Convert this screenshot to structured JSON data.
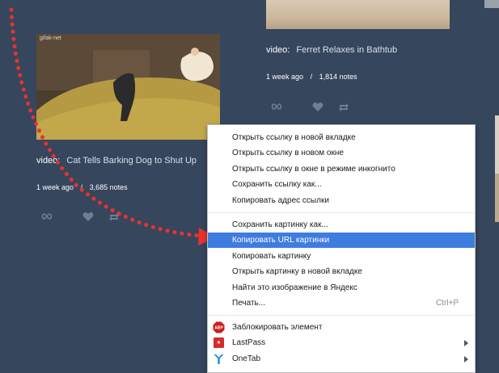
{
  "posts": {
    "left": {
      "kind": "video:",
      "title": "Cat Tells Barking Dog to Shut Up",
      "age": "1 week ago",
      "separator": "/",
      "notes": "3,685 notes",
      "watermark": "gifak-net"
    },
    "right": {
      "kind": "video:",
      "title": "Ferret Relaxes in Bathtub",
      "age": "1 week ago",
      "separator": "/",
      "notes": "1,814 notes"
    }
  },
  "context_menu": {
    "group_link": [
      "Открыть ссылку в новой вкладке",
      "Открыть ссылку в новом окне",
      "Открыть ссылку в окне в режиме инкогнито",
      "Сохранить ссылку как...",
      "Копировать адрес ссылки"
    ],
    "group_image": [
      "Сохранить картинку как...",
      "Копировать URL картинки",
      "Копировать картинку",
      "Открыть картинку в новой вкладке",
      "Найти это изображение в Яндекс",
      "Печать..."
    ],
    "print_shortcut": "Ctrl+P",
    "highlighted_item": "Копировать URL картинки",
    "extensions": [
      {
        "label": "Заблокировать элемент",
        "icon": "adblock-icon",
        "icon_text": "ABP"
      },
      {
        "label": "LastPass",
        "icon": "lastpass-icon"
      },
      {
        "label": "OneTab",
        "icon": "onetab-icon"
      }
    ]
  },
  "colors": {
    "background": "#36465d",
    "highlight": "#3f7ce0",
    "annotation_arrow": "#e8322e",
    "adblock_red": "#c8201c",
    "lastpass_red": "#d32d27",
    "onetab_blue": "#1d89d7"
  }
}
